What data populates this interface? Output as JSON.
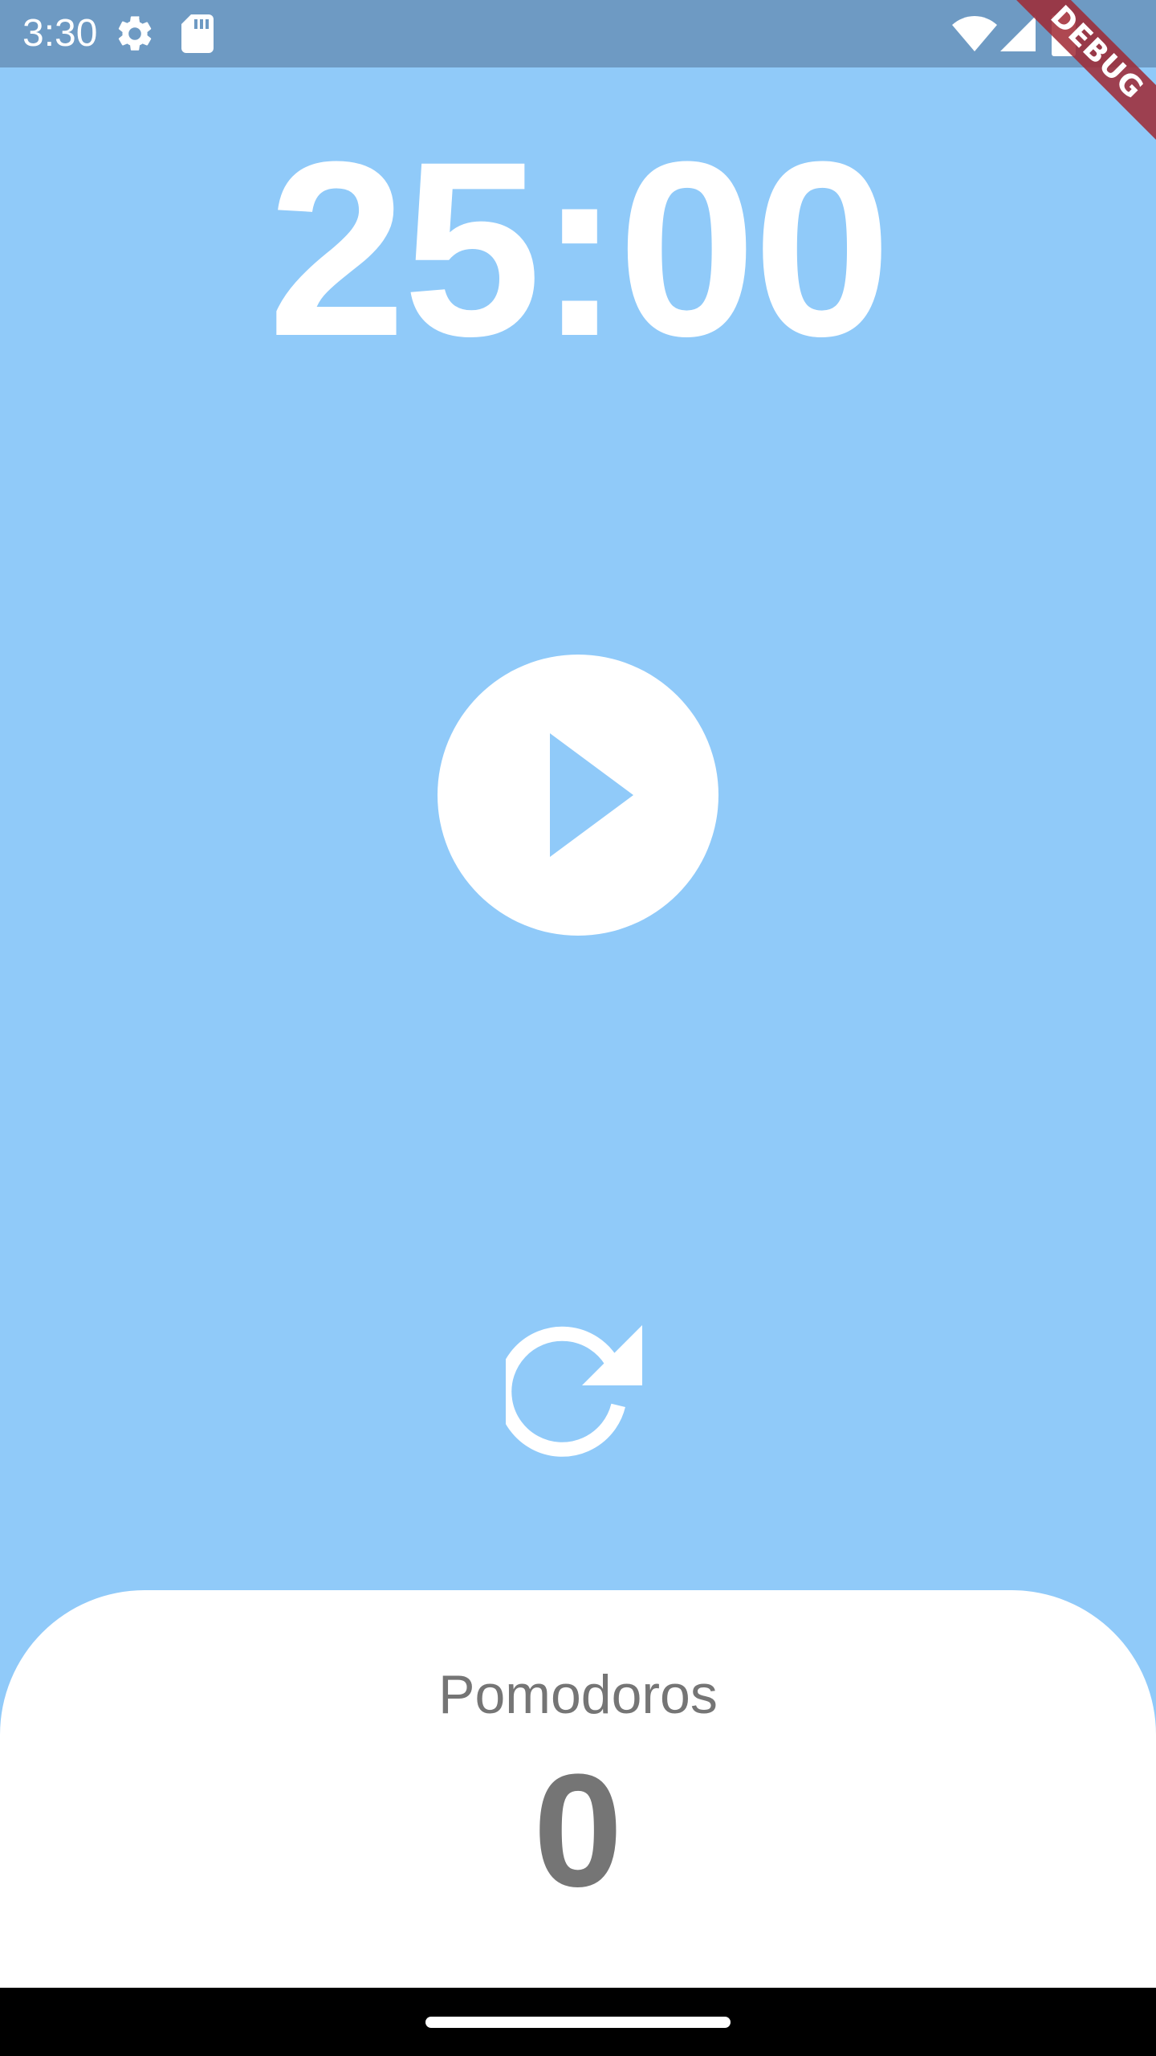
{
  "status_bar": {
    "time": "3:30",
    "icons": [
      "settings-gear-icon",
      "sd-card-icon",
      "wifi-icon",
      "signal-icon",
      "battery-icon"
    ],
    "background_color": "#6E9AC3"
  },
  "debug_banner": {
    "label": "DEBUG"
  },
  "timer": {
    "display": "25:00"
  },
  "controls": {
    "play_icon": "play-icon",
    "reset_icon": "refresh-icon"
  },
  "pomodoros": {
    "label": "Pomodoros",
    "count": "0"
  },
  "theme": {
    "background": "#90CAF9",
    "panel": "#FFFFFF",
    "text_muted": "#757575",
    "foreground": "#FFFFFF"
  }
}
